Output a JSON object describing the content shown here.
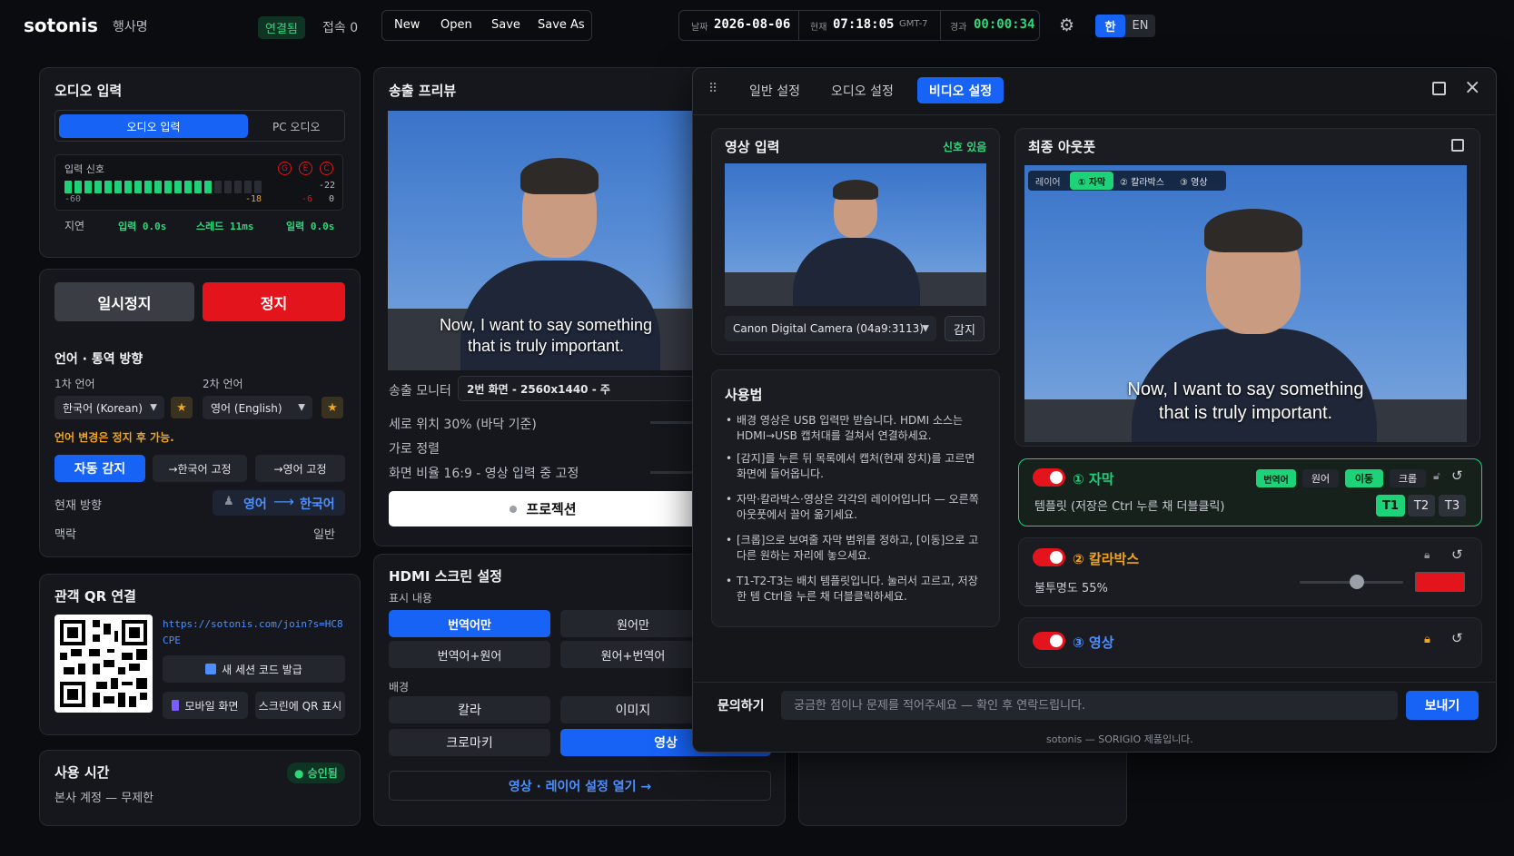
{
  "header": {
    "logo": "sotonis",
    "event": "행사명",
    "status": "연결됨",
    "listeners": "접속 0",
    "file_buttons": [
      "New",
      "Open",
      "Save",
      "Save As"
    ],
    "date_label": "날짜",
    "date": "2026-08-06",
    "now_label": "현재",
    "time": "07:18:05",
    "tz": "GMT-7",
    "elapsed_label": "경과",
    "elapsed": "00:00:34",
    "lang": [
      "한",
      "EN"
    ]
  },
  "audio": {
    "title": "오디오 입력",
    "tabs": [
      "오디오 입력",
      "PC 오디오"
    ],
    "signal_label": "입력 신호",
    "badges": [
      "G",
      "E",
      "C"
    ],
    "scale": [
      "-60",
      "-18",
      "-6",
      "0"
    ],
    "peak": "-22",
    "level": 0.82,
    "latency_label": "지연",
    "latency": [
      "입력 0.0s",
      "스레드 11ms",
      "일력 0.0s"
    ]
  },
  "control": {
    "pause": "일시정지",
    "stop": "정지",
    "lang_title": "언어 · 통역 방향",
    "lang1_label": "1차 언어",
    "lang2_label": "2차 언어",
    "lang1": "한국어 (Korean)",
    "lang2": "영어 (English)",
    "warn": "언어 변경은 정지 후 가능.",
    "dir_buttons": [
      "자동 감지",
      "→한국어 고정",
      "→영어 고정"
    ],
    "current_dir_label": "현재 방향",
    "dir_from": "영어",
    "dir_to": "한국어",
    "context_label": "맥락",
    "context": "일반"
  },
  "qr": {
    "title": "관객 QR 연결",
    "url": "https://sotonis.com/join?s=HC8CPE",
    "new_code": "새 세션 코드 발급",
    "mobile": "모바일 화면",
    "show_qr": "스크린에 QR 표시"
  },
  "usage": {
    "title": "사용 시간",
    "badge": "승인됨",
    "text": "본사 계정 — 무제한"
  },
  "preview": {
    "title": "송출 프리뷰",
    "sub1": "Now, I want to say something",
    "sub2": "that is truly important.",
    "monitor_label": "송출 모니터",
    "monitor": "2번 화면 - 2560x1440 - 주",
    "rows": [
      "세로 위치 30% (바닥 기준)",
      "가로 정렬",
      "화면 비율 16:9 - 영상 입력 중 고정"
    ],
    "projection": "프로젝션"
  },
  "hdmi": {
    "title": "HDMI 스크린 설정",
    "content_label": "표시 내용",
    "content_opts": [
      "번역어만",
      "원어만",
      "번역어+원어",
      "원어+번역어"
    ],
    "bg_label": "배경",
    "bg_opts": [
      "칼라",
      "이미지",
      "크로마키",
      "영상"
    ],
    "open_link": "영상 · 레이어 설정 열기 →"
  },
  "modal": {
    "tabs": [
      "일반 설정",
      "오디오 설정",
      "비디오 설정"
    ],
    "video_in": {
      "title": "영상 입력",
      "status": "신호 있음",
      "camera": "Canon Digital Camera (04a9:3113)",
      "detect": "감지"
    },
    "usage": {
      "title": "사용법",
      "bullets": [
        "배경 영상은 USB 입력만 받습니다. HDMI 소스는 HDMI→USB 캡처대를 걸쳐서 연결하세요.",
        "[감지]를 누른 뒤 목록에서 캡처(현재 장치)를 고르면 화면에 들어옵니다.",
        "자막·칼라박스·영상은 각각의 레이어입니다 — 오른쪽 아웃풋에서 끌어 옮기세요.",
        "[크롭]으로 보여줄 자막 범위를 정하고, [이동]으로 고 다른 원하는 자리에 놓으세요.",
        "T1-T2-T3는 배치 템플릿입니다. 눌러서 고르고, 저장한 템 Ctrl을 누른 채 더블클릭하세요."
      ]
    },
    "output": {
      "title": "최종 아웃풋",
      "layer_label": "레이어",
      "layers": [
        "① 자막",
        "② 칼라박스",
        "③ 영상"
      ],
      "sub1": "Now, I want to say something",
      "sub2": "that is truly important."
    },
    "layer1": {
      "name": "① 자막",
      "chips": [
        "번역어",
        "원어",
        "이동",
        "크롭"
      ],
      "template": "템플릿 (저장은 Ctrl 누른 채 더블클릭)",
      "t": [
        "T1",
        "T2",
        "T3"
      ]
    },
    "layer2": {
      "name": "② 칼라박스",
      "opacity": "불투명도 55%",
      "opacity_value": 0.55,
      "color": "#e3141b"
    },
    "layer3": {
      "name": "③ 영상"
    },
    "contact": {
      "label": "문의하기",
      "placeholder": "궁금한 점이나 문제를 적어주세요 — 확인 후 연락드립니다.",
      "send": "보내기"
    },
    "footer": "sotonis — SORIGIO 제품입니다."
  }
}
